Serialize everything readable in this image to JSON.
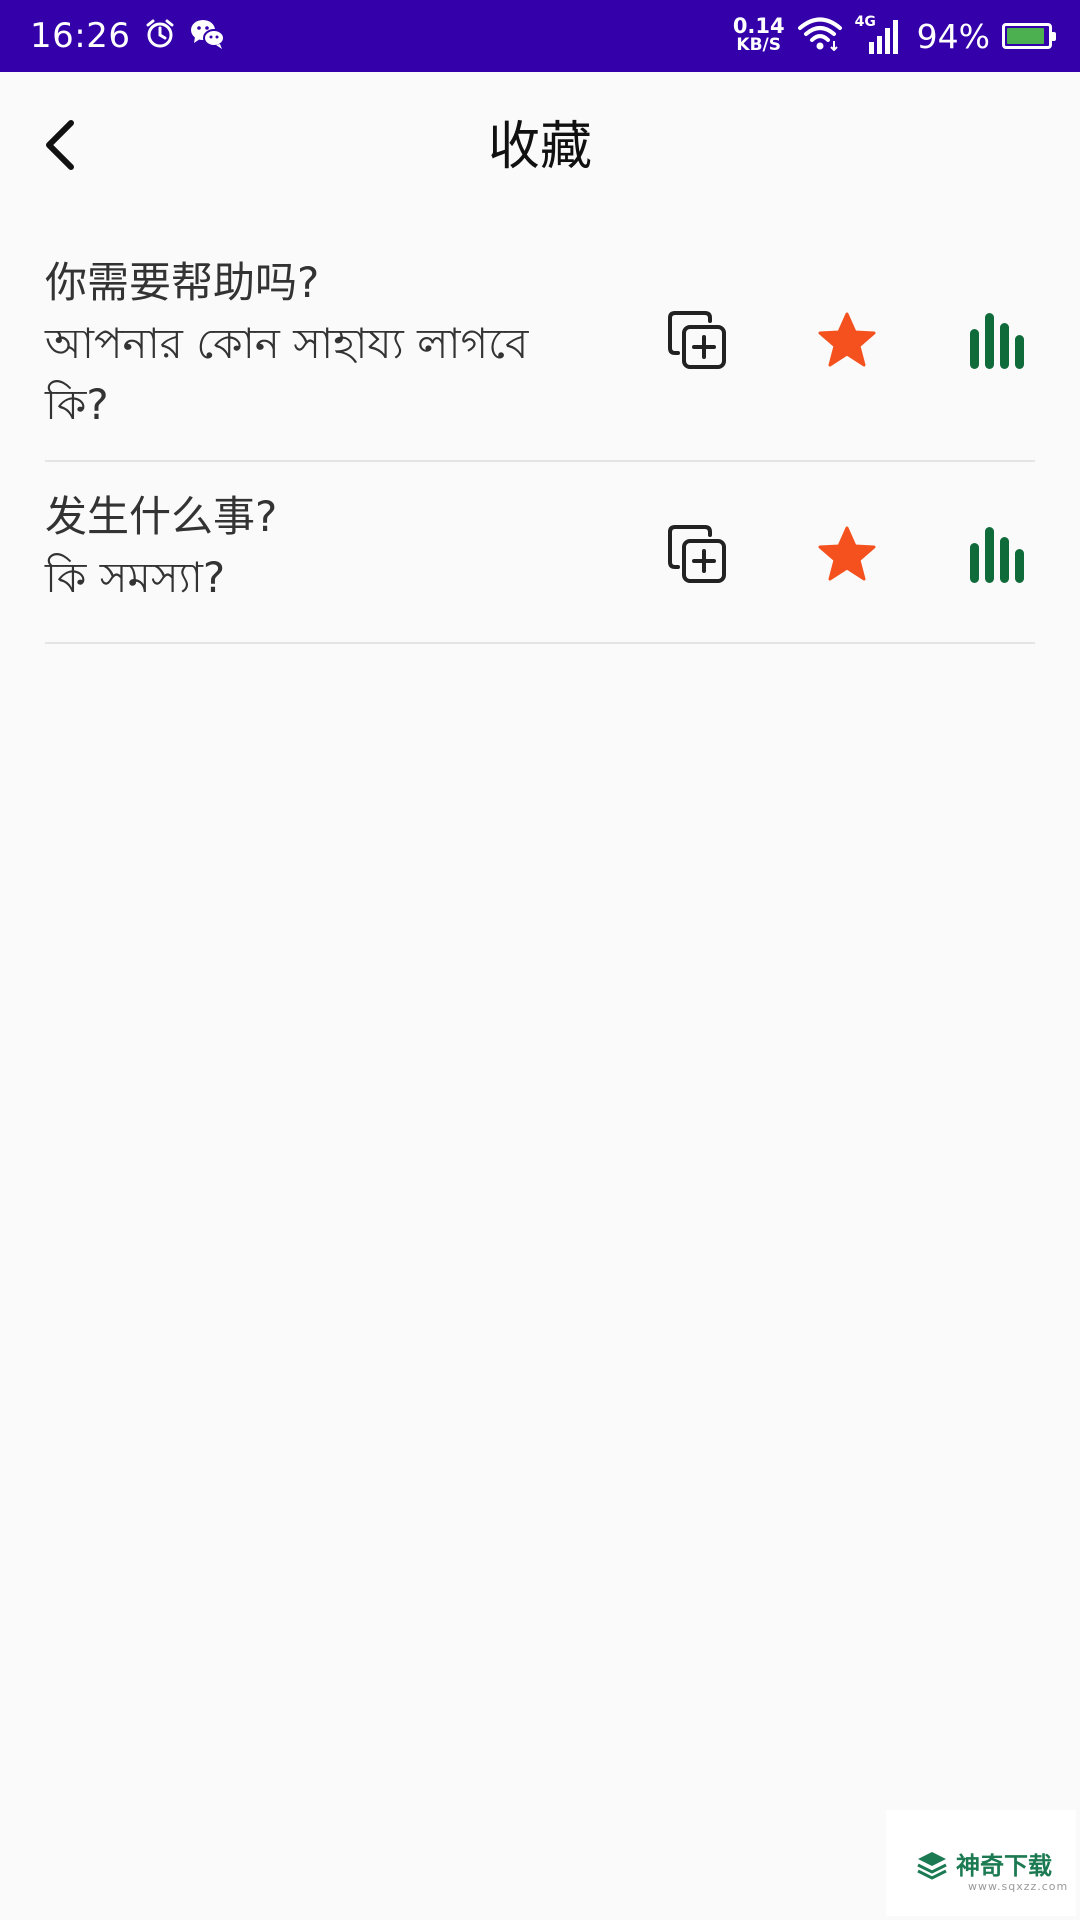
{
  "status_bar": {
    "time": "16:26",
    "net_speed_value": "0.14",
    "net_speed_unit": "KB/S",
    "network_type": "4G",
    "battery_percent": "94%",
    "battery_level": 0.94,
    "background_color": "#3300aa",
    "icons": [
      "alarm-icon",
      "wechat-icon",
      "wifi-icon",
      "cell-signal-icon",
      "battery-icon"
    ]
  },
  "header": {
    "title": "收藏",
    "back_icon": "chevron-left-icon"
  },
  "favorites": [
    {
      "chinese": "你需要帮助吗?",
      "bengali_line1": "আপনার কোন সাহায্য লাগবে",
      "bengali_line2": "কি?",
      "starred": true
    },
    {
      "chinese": "发生什么事?",
      "bengali_line1": "কি সমস্যা?",
      "bengali_line2": "",
      "starred": true
    }
  ],
  "action_icons": [
    "copy-add-icon",
    "star-icon",
    "audio-bars-icon"
  ],
  "colors": {
    "star": "#f4511e",
    "audio": "#0f6b3a",
    "divider": "#e4e4e4",
    "text": "#333333"
  },
  "watermark": {
    "text": "神奇下载",
    "url": "www.sqxzz.com"
  }
}
